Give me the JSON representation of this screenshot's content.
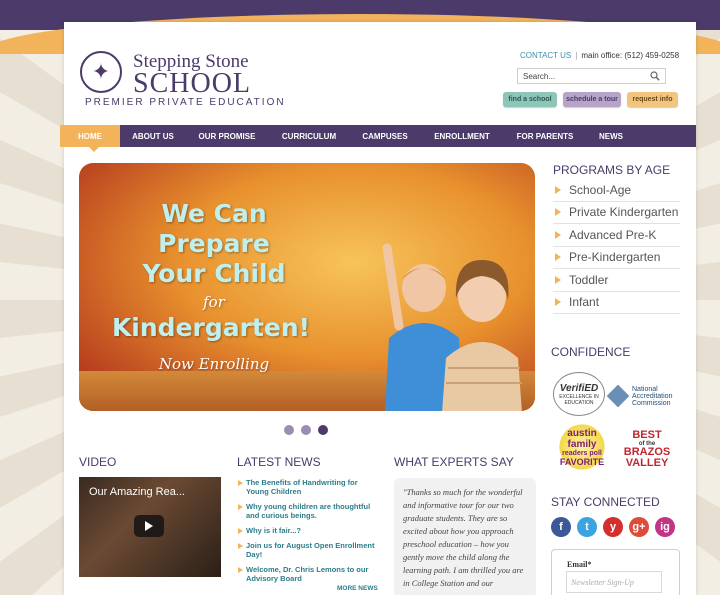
{
  "header": {
    "logo": {
      "line1": "Stepping Stone",
      "line2": "SCHOOL",
      "tagline": "PREMIER PRIVATE EDUCATION"
    },
    "contact_link": "CONTACT US",
    "separator": "|",
    "main_office": "main office: (512) 459-0258",
    "search": {
      "value": "Search..."
    },
    "buttons": {
      "find": "find a school",
      "tour": "schedule a tour",
      "request": "request info"
    }
  },
  "nav": {
    "items": [
      "HOME",
      "ABOUT US",
      "OUR PROMISE",
      "CURRICULUM",
      "CAMPUSES",
      "ENROLLMENT",
      "FOR PARENTS",
      "NEWS"
    ],
    "active_index": 0
  },
  "hero": {
    "line1": "We Can",
    "line2": "Prepare",
    "line3": "Your Child",
    "line4": "for",
    "line5": "Kindergarten!",
    "line6": "Now Enrolling",
    "slides": 3,
    "active_slide": 3
  },
  "programs": {
    "title": "PROGRAMS BY AGE",
    "items": [
      "School-Age",
      "Private Kindergarten",
      "Advanced Pre-K",
      "Pre-Kindergarten",
      "Toddler",
      "Infant"
    ]
  },
  "confidence": {
    "title": "CONFIDENCE",
    "verified": {
      "name": "VerifiED",
      "sub": "EXCELLENCE IN EDUCATION"
    },
    "nac": "National Accreditation Commission",
    "austin": {
      "l1": "austin family",
      "l2": "readers poll",
      "l3": "FAVORITE"
    },
    "best": {
      "l1": "BEST",
      "l2": "of the",
      "l3": "BRAZOS",
      "l4": "VALLEY"
    }
  },
  "stay_connected": {
    "title": "STAY CONNECTED",
    "icons": [
      "f",
      "t",
      "y",
      "g+",
      "ig"
    ],
    "colors": [
      "#3b5998",
      "#3ba3e0",
      "#d32f2f",
      "#dd4b39",
      "#c13584"
    ],
    "email_label": "Email*",
    "email_placeholder": "Newsletter Sign-Up"
  },
  "video": {
    "title": "VIDEO",
    "video_title": "Our Amazing Rea..."
  },
  "news": {
    "title": "LATEST NEWS",
    "items": [
      "The Benefits of Handwriting for Young Children",
      "Why young children are thoughtful and curious beings.",
      "Why is it fair...?",
      "Join us for August Open Enrollment Day!",
      "Welcome, Dr. Chris Lemons to our Advisory Board"
    ],
    "more": "MORE NEWS"
  },
  "experts": {
    "title": "WHAT EXPERTS SAY",
    "quote": "\"Thanks so much for the wonderful and informative tour for our two graduate students. They are so excited about how you approach preschool education – how you gently move the child along the learning path. I am thrilled you are in College Station and our"
  },
  "colors": {
    "brand_purple": "#4b3a6a",
    "accent_orange": "#f2b35b",
    "link_teal": "#2b7d8a"
  }
}
